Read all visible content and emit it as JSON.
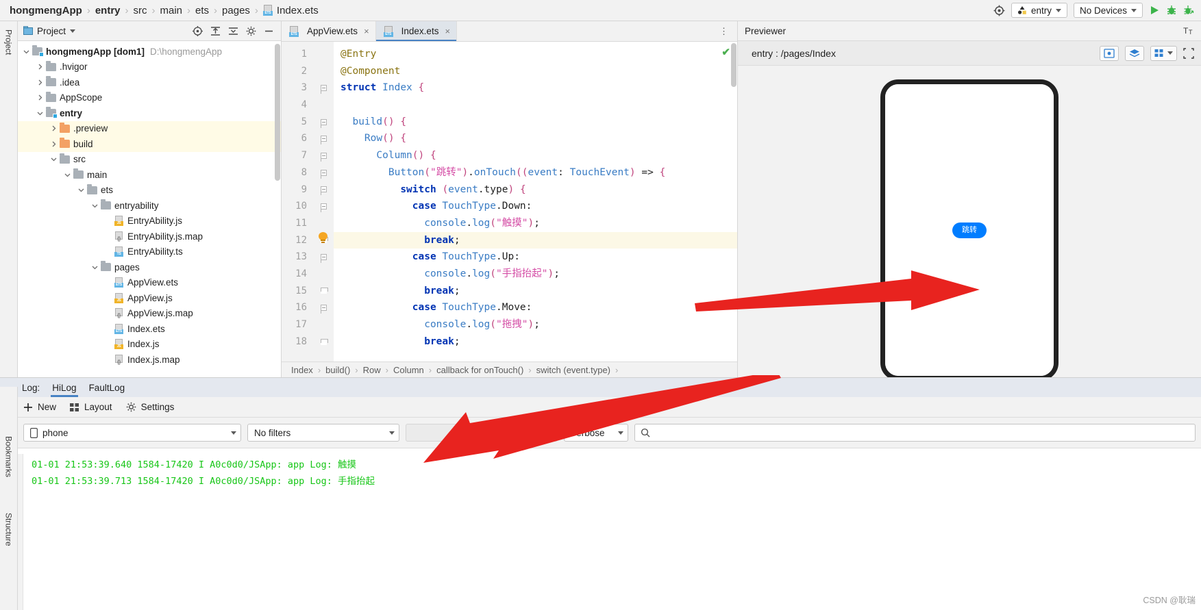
{
  "topbar": {
    "breadcrumbs": [
      {
        "label": "hongmengApp",
        "bold": true
      },
      {
        "label": "entry",
        "bold": true
      },
      {
        "label": "src",
        "bold": false
      },
      {
        "label": "main",
        "bold": false
      },
      {
        "label": "ets",
        "bold": false
      },
      {
        "label": "pages",
        "bold": false
      },
      {
        "label": "Index.ets",
        "bold": false
      }
    ],
    "separator": "›",
    "ets_badge_text": "ETS",
    "target_selector": "entry",
    "device_selector": "No Devices",
    "icons": [
      "target-icon",
      "run-icon",
      "debug-icon",
      "profile-icon"
    ]
  },
  "left_rail": {
    "top_tab": "Project",
    "bottom_tabs": [
      "Bookmarks",
      "Structure"
    ]
  },
  "project_panel": {
    "title": "Project",
    "header_icons": [
      "collapse-all-icon",
      "select-opened-file-icon",
      "expand-icon",
      "settings-icon",
      "hide-icon"
    ],
    "tree": [
      {
        "depth": 0,
        "arrow": "down",
        "icon": "folder-module",
        "label": "hongmengApp [dom1]",
        "bold": true,
        "path": "D:\\hongmengApp",
        "highlight": false
      },
      {
        "depth": 1,
        "arrow": "right",
        "icon": "folder",
        "label": ".hvigor",
        "bold": false,
        "path": "",
        "highlight": false
      },
      {
        "depth": 1,
        "arrow": "right",
        "icon": "folder",
        "label": ".idea",
        "bold": false,
        "path": "",
        "highlight": false
      },
      {
        "depth": 1,
        "arrow": "right",
        "icon": "folder",
        "label": "AppScope",
        "bold": false,
        "path": "",
        "highlight": false
      },
      {
        "depth": 1,
        "arrow": "down",
        "icon": "folder-module",
        "label": "entry",
        "bold": true,
        "path": "",
        "highlight": false
      },
      {
        "depth": 2,
        "arrow": "right",
        "icon": "folder-orange",
        "label": ".preview",
        "bold": false,
        "path": "",
        "highlight": true
      },
      {
        "depth": 2,
        "arrow": "right",
        "icon": "folder-orange",
        "label": "build",
        "bold": false,
        "path": "",
        "highlight": true
      },
      {
        "depth": 2,
        "arrow": "down",
        "icon": "folder",
        "label": "src",
        "bold": false,
        "path": "",
        "highlight": false
      },
      {
        "depth": 3,
        "arrow": "down",
        "icon": "folder",
        "label": "main",
        "bold": false,
        "path": "",
        "highlight": false
      },
      {
        "depth": 4,
        "arrow": "down",
        "icon": "folder",
        "label": "ets",
        "bold": false,
        "path": "",
        "highlight": false
      },
      {
        "depth": 5,
        "arrow": "down",
        "icon": "folder",
        "label": "entryability",
        "bold": false,
        "path": "",
        "highlight": false
      },
      {
        "depth": 6,
        "arrow": "none",
        "icon": "file-js",
        "label": "EntryAbility.js",
        "bold": false,
        "path": "",
        "highlight": false
      },
      {
        "depth": 6,
        "arrow": "none",
        "icon": "file-map",
        "label": "EntryAbility.js.map",
        "bold": false,
        "path": "",
        "highlight": false
      },
      {
        "depth": 6,
        "arrow": "none",
        "icon": "file-ts",
        "label": "EntryAbility.ts",
        "bold": false,
        "path": "",
        "highlight": false
      },
      {
        "depth": 5,
        "arrow": "down",
        "icon": "folder",
        "label": "pages",
        "bold": false,
        "path": "",
        "highlight": false
      },
      {
        "depth": 6,
        "arrow": "none",
        "icon": "file-ets",
        "label": "AppView.ets",
        "bold": false,
        "path": "",
        "highlight": false
      },
      {
        "depth": 6,
        "arrow": "none",
        "icon": "file-js",
        "label": "AppView.js",
        "bold": false,
        "path": "",
        "highlight": false
      },
      {
        "depth": 6,
        "arrow": "none",
        "icon": "file-map",
        "label": "AppView.js.map",
        "bold": false,
        "path": "",
        "highlight": false
      },
      {
        "depth": 6,
        "arrow": "none",
        "icon": "file-ets",
        "label": "Index.ets",
        "bold": false,
        "path": "",
        "highlight": false
      },
      {
        "depth": 6,
        "arrow": "none",
        "icon": "file-js",
        "label": "Index.js",
        "bold": false,
        "path": "",
        "highlight": false
      },
      {
        "depth": 6,
        "arrow": "none",
        "icon": "file-map",
        "label": "Index.js.map",
        "bold": false,
        "path": "",
        "highlight": false
      }
    ]
  },
  "editor": {
    "tabs": [
      {
        "label": "AppView.ets",
        "active": false,
        "icon": "ets-file-icon"
      },
      {
        "label": "Index.ets",
        "active": true,
        "icon": "ets-file-icon"
      }
    ],
    "close_glyph": "×",
    "menu_glyph": "⋮",
    "line_numbers": [
      1,
      2,
      3,
      4,
      5,
      6,
      7,
      8,
      9,
      10,
      11,
      12,
      13,
      14,
      15,
      16,
      17,
      18
    ],
    "highlight_line": 12,
    "inspection_ok_glyph": "✔",
    "lines": [
      "@Entry",
      "@Component",
      "struct Index {",
      "",
      "  build() {",
      "    Row() {",
      "      Column() {",
      "        Button(\"跳转\").onTouch((event: TouchEvent) => {",
      "          switch (event.type) {",
      "            case TouchType.Down:",
      "              console.log(\"触摸\");",
      "              break;",
      "            case TouchType.Up:",
      "              console.log(\"手指抬起\");",
      "              break;",
      "            case TouchType.Move:",
      "              console.log(\"拖拽\");",
      "              break;"
    ],
    "breadcrumbs": [
      "Index",
      "build()",
      "Row",
      "Column",
      "callback for onTouch()",
      "switch (event.type)"
    ],
    "breadcrumb_sep": "›"
  },
  "previewer": {
    "title": "Previewer",
    "settings_glyph": "T̲ₜ",
    "route": "entry : /pages/Index",
    "tool_icons": [
      "inspector-icon",
      "layers-icon",
      "grid-icon",
      "chevron-down-icon",
      "device-frame-icon"
    ],
    "device": {
      "button_label": "跳转"
    }
  },
  "log": {
    "label": "Log:",
    "tabs": [
      {
        "label": "HiLog",
        "active": true
      },
      {
        "label": "FaultLog",
        "active": false
      }
    ],
    "toolbar": [
      {
        "label": "New",
        "icon": "plus-icon"
      },
      {
        "label": "Layout",
        "icon": "layout-icon"
      },
      {
        "label": "Settings",
        "icon": "gear-icon"
      }
    ],
    "filters": {
      "device": "phone",
      "filter": "No filters",
      "process": "",
      "level": "Verbose",
      "search_placeholder": ""
    },
    "lines": [
      "01-01 21:53:39.640 1584-17420 I A0c0d0/JSApp: app Log: 触摸",
      "01-01 21:53:39.713 1584-17420 I A0c0d0/JSApp: app Log: 手指抬起"
    ],
    "line_color": "#17c617",
    "rail_icons": [
      "scroll-up-icon",
      "scroll-down-icon",
      "wrap-icon",
      "download-icon",
      "restart-icon"
    ]
  },
  "watermark": "CSDN @耿瑞",
  "annotations": {
    "arrow_color": "#e8231f",
    "arrow_1_name": "arrow-to-preview-button",
    "arrow_2_name": "arrow-to-log-output"
  }
}
